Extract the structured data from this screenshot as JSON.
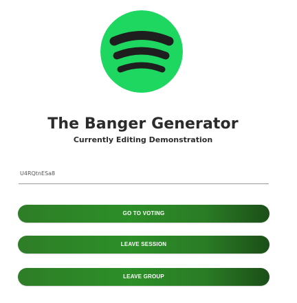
{
  "logo": {
    "icon": "spotify-logo-icon",
    "circle_color": "#1ED760",
    "bar_color": "#1e1e1e"
  },
  "header": {
    "title": "The Banger Generator",
    "subtitle": "Currently Editing Demonstration"
  },
  "session": {
    "code": "U4RQtnESa8"
  },
  "buttons": {
    "go_to_voting": "GO TO VOTING",
    "leave_session": "LEAVE SESSION",
    "leave_group": "LEAVE GROUP"
  },
  "colors": {
    "button_green": "#2C8F27",
    "button_dark": "#1B4F18",
    "text": "#2B2B2B"
  }
}
